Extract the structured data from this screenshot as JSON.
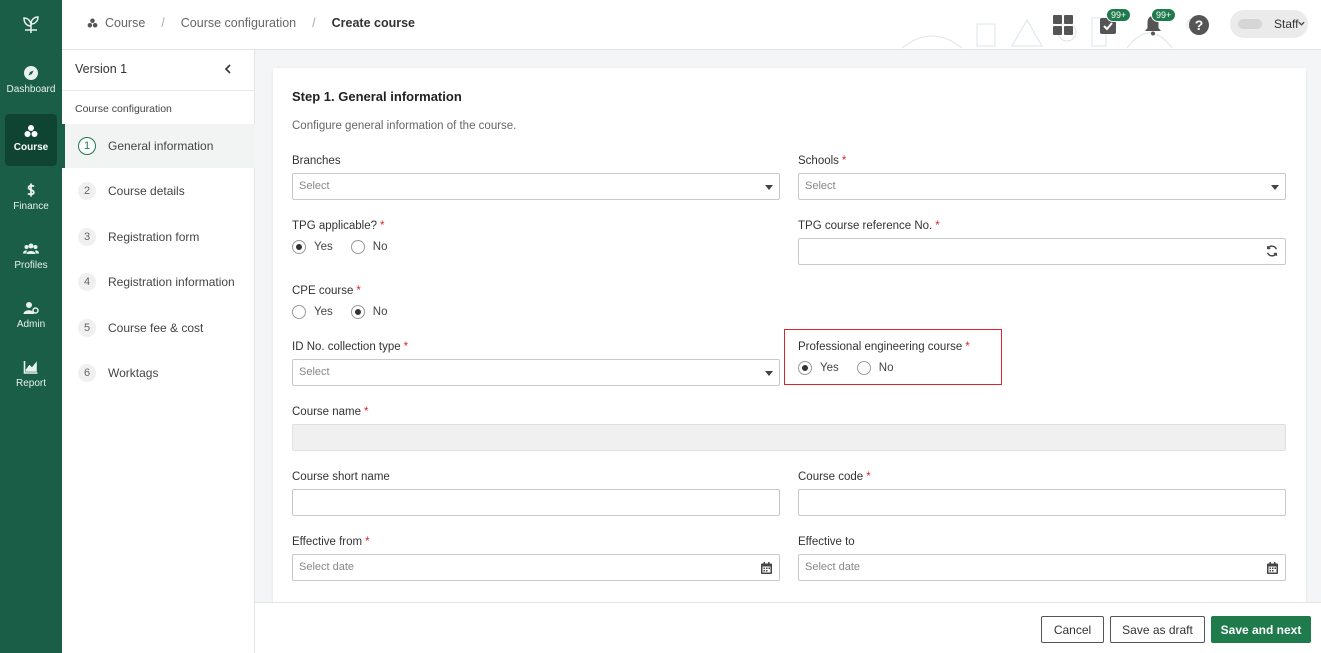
{
  "nav": {
    "items": [
      {
        "label": "Dashboard",
        "icon": "compass-icon"
      },
      {
        "label": "Course",
        "icon": "course-icon"
      },
      {
        "label": "Finance",
        "icon": "dollar-icon"
      },
      {
        "label": "Profiles",
        "icon": "people-icon"
      },
      {
        "label": "Admin",
        "icon": "admin-icon"
      },
      {
        "label": "Report",
        "icon": "chart-icon"
      }
    ],
    "active": "Course"
  },
  "header": {
    "breadcrumb": [
      "Course",
      "Course configuration",
      "Create course"
    ],
    "tasks_badge": "99+",
    "notifications_badge": "99+",
    "user_role": "Staff"
  },
  "steps": {
    "version": "Version 1",
    "section_label": "Course configuration",
    "items": [
      {
        "num": "1",
        "label": "General information"
      },
      {
        "num": "2",
        "label": "Course details"
      },
      {
        "num": "3",
        "label": "Registration form"
      },
      {
        "num": "4",
        "label": "Registration information"
      },
      {
        "num": "5",
        "label": "Course fee & cost"
      },
      {
        "num": "6",
        "label": "Worktags"
      }
    ]
  },
  "form": {
    "title": "Step 1. General information",
    "description": "Configure general information of the course.",
    "required_mark": "*",
    "branches": {
      "label": "Branches",
      "placeholder": "Select"
    },
    "schools": {
      "label": "Schools",
      "placeholder": "Select"
    },
    "tpg_applicable": {
      "label": "TPG applicable?",
      "yes": "Yes",
      "no": "No",
      "value": "Yes"
    },
    "tpg_ref": {
      "label": "TPG course reference No.",
      "value": ""
    },
    "cpe_course": {
      "label": "CPE course",
      "yes": "Yes",
      "no": "No",
      "value": "No"
    },
    "id_collection": {
      "label": "ID No. collection type",
      "placeholder": "Select"
    },
    "pro_eng": {
      "label": "Professional engineering course",
      "yes": "Yes",
      "no": "No",
      "value": "Yes"
    },
    "course_name": {
      "label": "Course name",
      "value": ""
    },
    "course_short_name": {
      "label": "Course short name",
      "value": ""
    },
    "course_code": {
      "label": "Course code",
      "value": ""
    },
    "effective_from": {
      "label": "Effective from",
      "placeholder": "Select date"
    },
    "effective_to": {
      "label": "Effective to",
      "placeholder": "Select date"
    }
  },
  "footer": {
    "cancel": "Cancel",
    "save_draft": "Save as draft",
    "save_next": "Save and next"
  }
}
